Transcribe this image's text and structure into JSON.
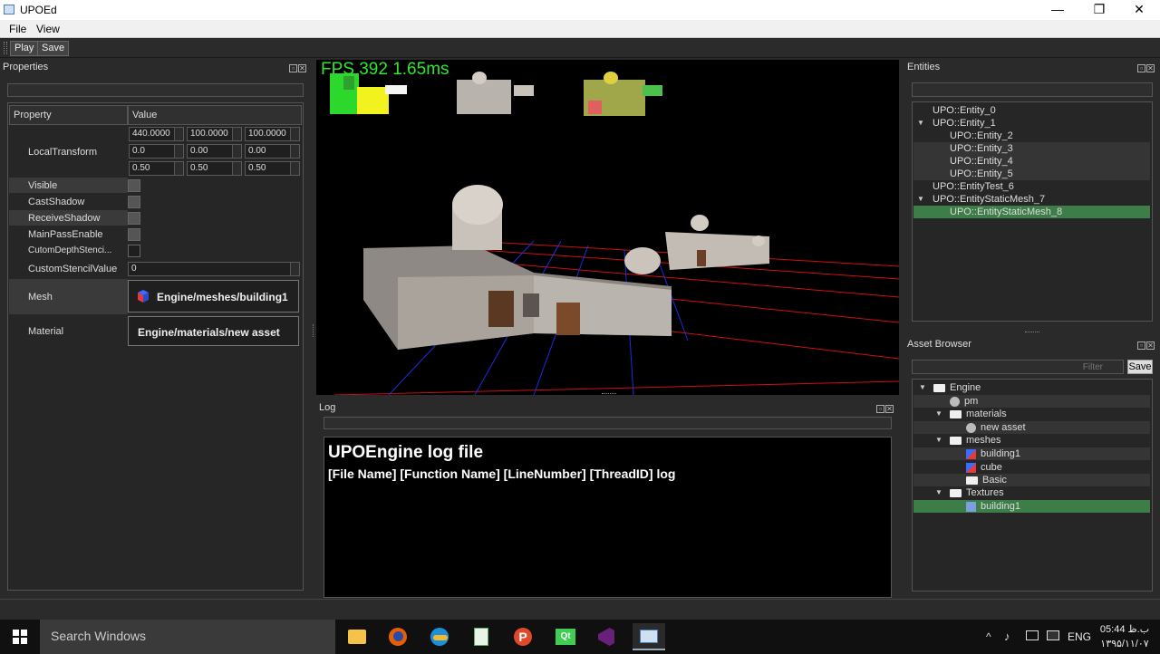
{
  "window": {
    "title": "UPOEd",
    "minimize": "—",
    "restore": "❐",
    "close": "✕"
  },
  "menu": [
    "File",
    "View"
  ],
  "toolbar": {
    "play": "Play",
    "save": "Save"
  },
  "properties": {
    "title": "Properties",
    "col_property": "Property",
    "col_value": "Value",
    "local_transform": {
      "label": "LocalTransform",
      "row1": [
        "440.0000",
        "100.0000",
        "100.0000"
      ],
      "row2": [
        "0.0",
        "0.00",
        "0.00"
      ],
      "row3": [
        "0.50",
        "0.50",
        "0.50"
      ]
    },
    "visible": "Visible",
    "cast_shadow": "CastShadow",
    "receive_shadow": "ReceiveShadow",
    "main_pass": "MainPassEnable",
    "custom_depth": "CutomDepthStenci...",
    "custom_stencil": "CustomStencilValue",
    "custom_stencil_value": "0",
    "mesh_label": "Mesh",
    "mesh_value": "Engine/meshes/building1",
    "material_label": "Material",
    "material_value": "Engine/materials/new asset"
  },
  "viewport": {
    "fps": "FPS 392  1.65ms"
  },
  "log": {
    "title": "Log",
    "heading": "UPOEngine log file",
    "subheading": "[File Name] [Function Name] [LineNumber] [ThreadID] log"
  },
  "entities": {
    "title": "Entities",
    "items": [
      {
        "label": "UPO::Entity_0",
        "depth": 0,
        "arrow": ""
      },
      {
        "label": "UPO::Entity_1",
        "depth": 0,
        "arrow": "▼"
      },
      {
        "label": "UPO::Entity_2",
        "depth": 1,
        "arrow": ""
      },
      {
        "label": "UPO::Entity_3",
        "depth": 1,
        "arrow": ""
      },
      {
        "label": "UPO::Entity_4",
        "depth": 1,
        "arrow": ""
      },
      {
        "label": "UPO::Entity_5",
        "depth": 1,
        "arrow": ""
      },
      {
        "label": "UPO::EntityTest_6",
        "depth": 0,
        "arrow": ""
      },
      {
        "label": "UPO::EntityStaticMesh_7",
        "depth": 0,
        "arrow": "▼"
      },
      {
        "label": "UPO::EntityStaticMesh_8",
        "depth": 1,
        "arrow": ""
      }
    ]
  },
  "assets": {
    "title": "Asset Browser",
    "filter_placeholder": "Filter",
    "save": "Save",
    "items": [
      {
        "label": "Engine",
        "kind": "folder"
      },
      {
        "label": "pm",
        "kind": "material"
      },
      {
        "label": "materials",
        "kind": "folder"
      },
      {
        "label": "new asset",
        "kind": "material"
      },
      {
        "label": "meshes",
        "kind": "folder"
      },
      {
        "label": "building1",
        "kind": "mesh"
      },
      {
        "label": "cube",
        "kind": "mesh"
      },
      {
        "label": "Basic",
        "kind": "folder"
      },
      {
        "label": "Textures",
        "kind": "folder"
      },
      {
        "label": "building1",
        "kind": "texture"
      }
    ]
  },
  "taskbar": {
    "search": "Search Windows",
    "lang": "ENG",
    "time": "05:44 ب.ظ",
    "date": "۱۳۹۵/۱۱/۰۷"
  }
}
